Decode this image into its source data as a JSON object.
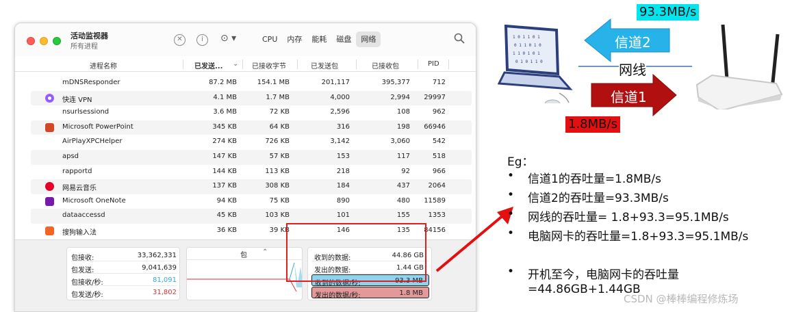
{
  "window": {
    "title": "活动监视器",
    "subtitle": "所有进程",
    "tabs": [
      {
        "label": "CPU",
        "active": false
      },
      {
        "label": "内存",
        "active": false
      },
      {
        "label": "能耗",
        "active": false
      },
      {
        "label": "磁盘",
        "active": false
      },
      {
        "label": "网络",
        "active": true
      }
    ],
    "toolbar_icons": [
      "stop-icon",
      "info-icon",
      "more-actions-icon",
      "search-icon"
    ]
  },
  "table": {
    "columns": [
      "进程名称",
      "已发送...",
      "已接收字节",
      "已发送包",
      "已接收包",
      "PID"
    ],
    "rows": [
      {
        "name": "mDNSResponder",
        "sent": "87.2 MB",
        "recv": "154.1 MB",
        "sent_p": "201,117",
        "recv_p": "395,377",
        "pid": "712",
        "icon": "none"
      },
      {
        "name": "快连 VPN",
        "sent": "4.1 MB",
        "recv": "1.7 MB",
        "sent_p": "4,000",
        "recv_p": "2,994",
        "pid": "29997",
        "icon": "vpn-icon"
      },
      {
        "name": "nsurlsessiond",
        "sent": "3.6 MB",
        "recv": "72 KB",
        "sent_p": "2,596",
        "recv_p": "108",
        "pid": "962",
        "icon": "none"
      },
      {
        "name": "Microsoft PowerPoint",
        "sent": "345 KB",
        "recv": "64 KB",
        "sent_p": "316",
        "recv_p": "198",
        "pid": "66946",
        "icon": "powerpoint-icon"
      },
      {
        "name": "AirPlayXPCHelper",
        "sent": "274 KB",
        "recv": "726 KB",
        "sent_p": "3,142",
        "recv_p": "3,060",
        "pid": "542",
        "icon": "none"
      },
      {
        "name": "apsd",
        "sent": "147 KB",
        "recv": "57 KB",
        "sent_p": "153",
        "recv_p": "117",
        "pid": "518",
        "icon": "none"
      },
      {
        "name": "rapportd",
        "sent": "144 KB",
        "recv": "113 KB",
        "sent_p": "218",
        "recv_p": "92",
        "pid": "966",
        "icon": "none"
      },
      {
        "name": "网易云音乐",
        "sent": "137 KB",
        "recv": "308 KB",
        "sent_p": "184",
        "recv_p": "437",
        "pid": "2064",
        "icon": "netease-music-icon"
      },
      {
        "name": "Microsoft OneNote",
        "sent": "94 KB",
        "recv": "75 KB",
        "sent_p": "890",
        "recv_p": "480",
        "pid": "11589",
        "icon": "onenote-icon"
      },
      {
        "name": "dataaccessd",
        "sent": "45 KB",
        "recv": "103 KB",
        "sent_p": "101",
        "recv_p": "155",
        "pid": "1353",
        "icon": "none"
      },
      {
        "name": "搜狗输入法",
        "sent": "36 KB",
        "recv": "39 KB",
        "sent_p": "146",
        "recv_p": "135",
        "pid": "84156",
        "icon": "sogou-icon"
      }
    ]
  },
  "stats": {
    "recv_packets_label": "包接收:",
    "recv_packets": "33,362,331",
    "sent_packets_label": "包发送:",
    "sent_packets": "9,041,639",
    "recv_rate_label": "包接收/秒:",
    "recv_rate": "81,091",
    "sent_rate_label": "包发送/秒:",
    "sent_rate": "31,802"
  },
  "graph": {
    "selector": "包",
    "selector_icon": "updown-icon"
  },
  "data": {
    "recv_label": "收到的数据:",
    "recv": "44.86 GB",
    "sent_label": "发出的数据:",
    "sent": "1.44 GB",
    "recv_sec_label": "收到的数据/秒:",
    "recv_sec": "93.3 MB",
    "sent_sec_label": "发出的数据/秒:",
    "sent_sec": "1.8 MB"
  },
  "diagram": {
    "speed_top": "93.3MB/s",
    "speed_bottom": "1.8MB/s",
    "channel2": "信道2",
    "channel1": "信道1",
    "cable": "网线",
    "colors": {
      "cyan": "#00e5ee",
      "red": "#e21010",
      "arrow_blue": "#27b3ea",
      "arrow_red": "#b01010"
    }
  },
  "notes": {
    "eg": "Eg：",
    "bullets": [
      "信道1的吞吐量=1.8MB/s",
      "信道2的吞吐量=93.3MB/s",
      "网线的吞吐量= 1.8+93.3=95.1MB/s",
      "电脑网卡的吞吐量=1.8+93.3=95.1MB/s",
      "开机至今，电脑网卡的吞吐量",
      "=44.86GB+1.44GB"
    ],
    "bullet_glyph": "•"
  },
  "watermark": "CSDN @棒棒编程修炼场"
}
